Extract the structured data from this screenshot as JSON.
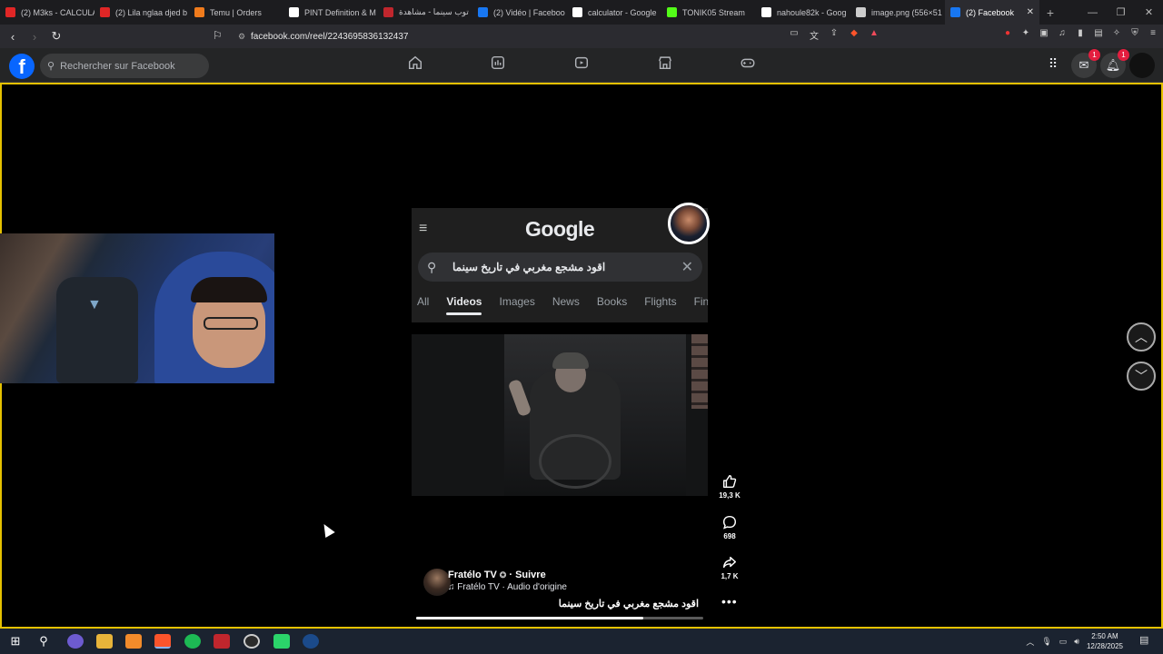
{
  "tabs": [
    {
      "title": "(2) M3ks - CALCULA",
      "color": "#e02626"
    },
    {
      "title": "(2) Lila nglaa djed b",
      "color": "#e02626"
    },
    {
      "title": "Temu | Orders",
      "color": "#f07b1c"
    },
    {
      "title": "PINT Definition & M",
      "color": "#ffffff"
    },
    {
      "title": "توب سينما - مشاهدة",
      "color": "#c0262d"
    },
    {
      "title": "(2) Vidéo | Faceboo",
      "color": "#1877f2"
    },
    {
      "title": "calculator - Google",
      "color": "#ffffff"
    },
    {
      "title": "TONIK05 Stream",
      "color": "#53fc18"
    },
    {
      "title": "nahoule82k - Goog",
      "color": "#ffffff"
    },
    {
      "title": "image.png (556×51",
      "color": "#cccccc"
    },
    {
      "title": "(2) Facebook",
      "color": "#1877f2"
    }
  ],
  "browser": {
    "url": "facebook.com/reel/2243695836132437",
    "new_tab": "+"
  },
  "facebook": {
    "logo": "f",
    "search_placeholder": "Rechercher sur Facebook",
    "messenger_badge": "1",
    "notifications_badge": "1"
  },
  "reel": {
    "google": {
      "logo": "Google",
      "query": "اقود مشجع مغربي في تاريخ سينما",
      "tabs": [
        "All",
        "Videos",
        "Images",
        "News",
        "Books",
        "Flights",
        "Fina"
      ],
      "selected_tab": "Videos"
    },
    "author": "Fratélo TV",
    "follow": "· Suivre",
    "audio": "♫ Fratélo TV · Audio d'origine",
    "caption": "اقود مشجع مغربي في تاريخ سينما",
    "progress": 0.79,
    "likes": "19,3 K",
    "comments": "698",
    "shares": "1,7 K"
  },
  "taskbar": {
    "time": "2:50 AM",
    "date": "12/28/2025"
  },
  "colors": {
    "facebook_blue": "#0866ff",
    "stage_border": "#e5c100"
  }
}
